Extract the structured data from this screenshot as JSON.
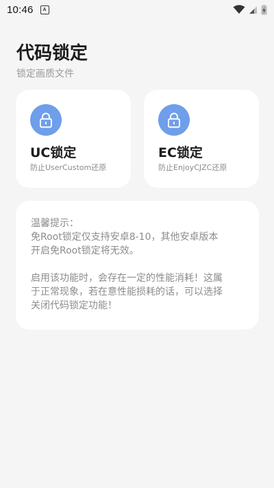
{
  "status_bar": {
    "time": "10:46",
    "notification_glyph": "A",
    "icons": [
      "wifi-icon",
      "cellular-signal-icon",
      "battery-charging-icon"
    ]
  },
  "header": {
    "title": "代码锁定",
    "subtitle": "锁定画质文件"
  },
  "lock_cards": [
    {
      "icon": "lock-icon",
      "title": "UC锁定",
      "description": "防止UserCustom还原"
    },
    {
      "icon": "lock-icon",
      "title": "EC锁定",
      "description": "防止EnjoyCJZC还原"
    }
  ],
  "tips": {
    "heading": "温馨提示：",
    "paragraph1_lines": [
      "免Root锁定仅支持安卓8-10，其他安卓版本",
      "开启免Root锁定将无效。"
    ],
    "paragraph2_lines": [
      "启用该功能时，会存在一定的性能消耗！这属",
      "于正常现象，若在意性能损耗的话，可以选择",
      "关闭代码锁定功能！"
    ]
  },
  "colors": {
    "background": "#f5f5f5",
    "card": "#ffffff",
    "accent": "#6f9eea"
  }
}
